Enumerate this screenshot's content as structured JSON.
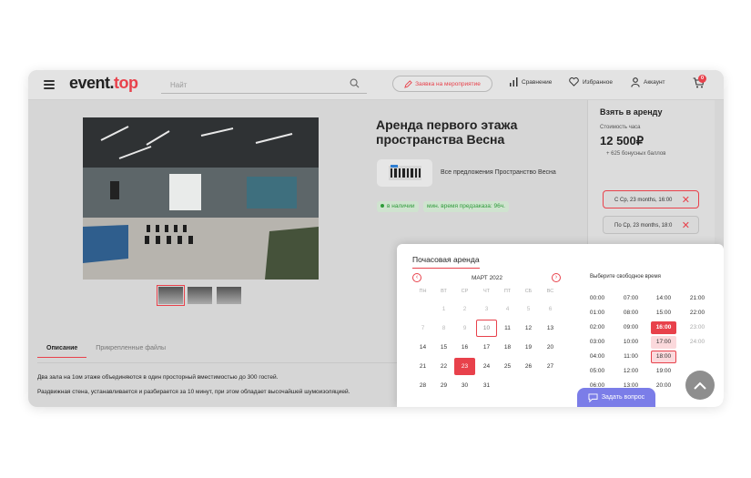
{
  "header": {
    "logo_main": "event.",
    "logo_tld": "top",
    "search_placeholder": "Найт",
    "request_button": "Заявка на мероприятие",
    "compare": "Сравнение",
    "favorites": "Избранное",
    "account": "Аккаунт",
    "cart_count": "0"
  },
  "product": {
    "title": "Аренда первого этажа пространства Весна",
    "org_link": "Все предложения Пространство Весна",
    "in_stock": "в наличии",
    "min_time": "мин. время предзаказа: 96ч."
  },
  "rent": {
    "heading": "Взять в аренду",
    "price_label": "Стоимость часа",
    "price": "12 500",
    "currency": "₽",
    "bonus": "+ 625 бонусных баллов",
    "from_slot": "С Ср, 23 months, 16:00",
    "to_slot": "По Ср, 23 months, 18:0"
  },
  "tabs": {
    "description": "Описание",
    "files": "Прикрепленные файлы"
  },
  "description": {
    "line1": "Два зала на 1ом этаже объединяются в один просторный вместимостью до 300 гостей.",
    "line2": "Раздвижная стена, устанавливается и разбирается за 10 минут, при этом обладает высочайшей шумоизоляцией."
  },
  "calendar": {
    "title": "Почасовая аренда",
    "month": "МАРТ 2022",
    "weekdays": [
      "ПН",
      "ВТ",
      "СР",
      "ЧТ",
      "ПТ",
      "СБ",
      "ВС"
    ],
    "times_label": "Выберите свободное время"
  },
  "ask_button": "Задать вопрос",
  "colors": {
    "accent": "#e8414b",
    "ask": "#7b7de8"
  },
  "icons": [
    "menu-icon",
    "search-icon",
    "pen-icon",
    "compare-icon",
    "heart-icon",
    "user-icon",
    "cart-icon",
    "chevron-left-icon",
    "chevron-right-icon",
    "close-icon",
    "chat-icon",
    "arrow-up-icon"
  ]
}
